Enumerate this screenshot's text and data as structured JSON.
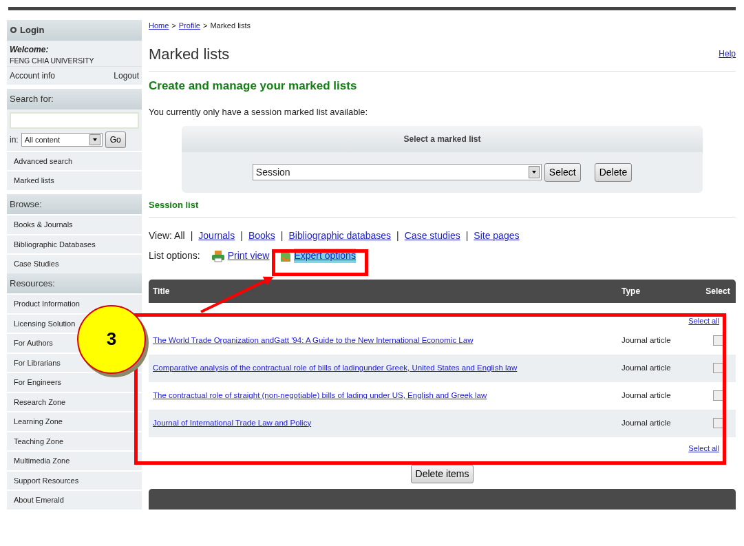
{
  "sidebar": {
    "login": {
      "title": "Login",
      "welcome": "Welcome:",
      "institution": "FENG CHIA UNIVERSITY",
      "account_link": "Account info",
      "logout_link": "Logout"
    },
    "search": {
      "title": "Search for:",
      "scope_label": "in:",
      "scope": "All content",
      "go": "Go",
      "links": [
        "Advanced search",
        "Marked lists"
      ]
    },
    "sections": [
      {
        "title": "Browse:",
        "items": [
          "Books & Journals",
          "Bibliographic Databases",
          "Case Studies"
        ]
      },
      {
        "title": "Resources:",
        "items": [
          "Product Information",
          "Licensing Solution",
          "For Authors",
          "For Librarians",
          "For Engineers",
          "Research Zone",
          "Learning Zone",
          "Teaching Zone",
          "Multimedia Zone",
          "Support Resources",
          "About Emerald"
        ]
      }
    ]
  },
  "breadcrumb": [
    {
      "kind": "link",
      "label": "Home"
    },
    {
      "kind": "separator",
      "label": ">"
    },
    {
      "kind": "link",
      "label": "Profile"
    },
    {
      "kind": "separator",
      "label": ">"
    },
    {
      "kind": "text",
      "label": "Marked lists"
    }
  ],
  "page_title": "Marked lists",
  "help": "Help",
  "subtitle": "Create and manage your marked lists",
  "intro": "You currently only have a session marked list available:",
  "selector": {
    "title": "Select a marked list",
    "value": "Session",
    "buttons": [
      "Select",
      "Delete"
    ]
  },
  "session_label": "Session list",
  "view": {
    "label": "View: All",
    "items": [
      {
        "kind": "separator",
        "label": "|"
      },
      {
        "kind": "link",
        "label": "Journals"
      },
      {
        "kind": "separator",
        "label": "|"
      },
      {
        "kind": "link",
        "label": "Books"
      },
      {
        "kind": "separator",
        "label": "|"
      },
      {
        "kind": "link",
        "label": "Bibliographic databases"
      },
      {
        "kind": "separator",
        "label": "|"
      },
      {
        "kind": "link",
        "label": "Case studies"
      },
      {
        "kind": "separator",
        "label": "|"
      },
      {
        "kind": "link",
        "label": "Site pages"
      }
    ]
  },
  "list_options": {
    "label": "List options:",
    "items": [
      {
        "kind": "print",
        "label": "Print view",
        "selected": false
      },
      {
        "kind": "expert",
        "label": "Expert options",
        "selected": true
      }
    ]
  },
  "table": {
    "columns": [
      "Title",
      "Type",
      "Select"
    ],
    "select_all": "Select all",
    "rows": [
      {
        "title": "The World Trade Organization andGatt '94: A Guide to the New International Economic Law",
        "type": "Journal article",
        "checked": false
      },
      {
        "title": "Comparative analysis of the contractual role of bills of ladingunder Greek, United States and English law",
        "type": "Journal article",
        "checked": false
      },
      {
        "title": "The contractual role of straight (non-negotiable) bills of lading under US, English and Greek law",
        "type": "Journal article",
        "checked": false
      },
      {
        "title": "Journal of International Trade Law and Policy",
        "type": "Journal article",
        "checked": false
      }
    ],
    "select_all_bottom": "Select all",
    "delete": "Delete items"
  },
  "callout": {
    "number": "3"
  }
}
